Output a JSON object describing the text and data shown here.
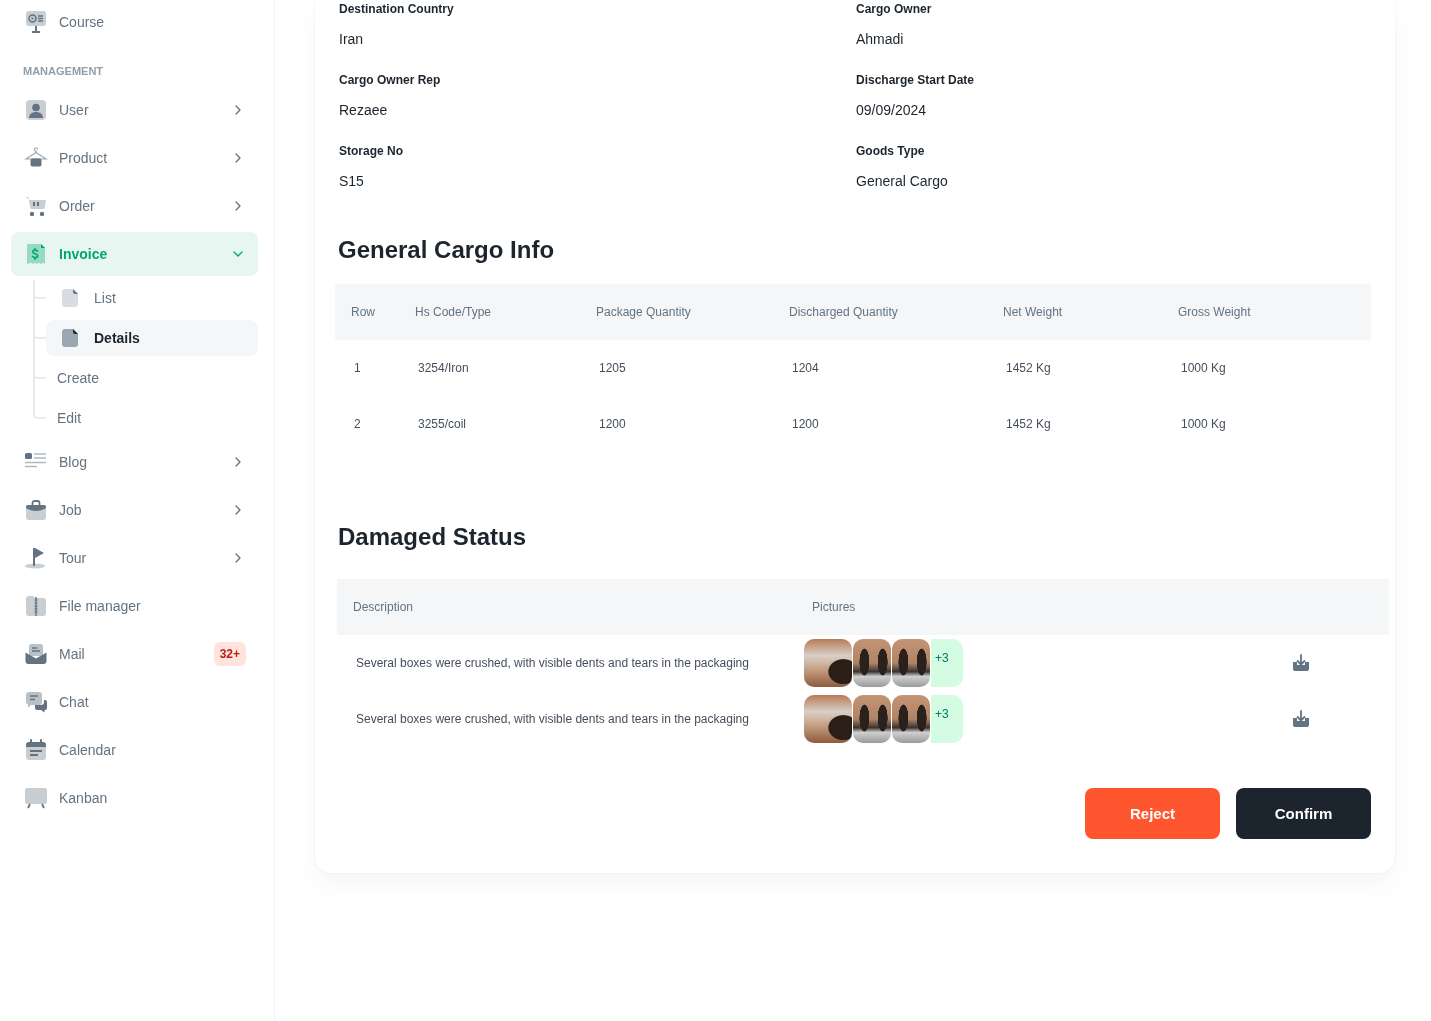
{
  "sidebar": {
    "sections": [
      {
        "items": [
          {
            "label": "Course",
            "kind": "link",
            "selected": false,
            "expanded": false
          }
        ]
      },
      {
        "title": "MANAGEMENT",
        "items": [
          {
            "label": "User",
            "kind": "group",
            "selected": false,
            "expanded": false
          },
          {
            "label": "Product",
            "kind": "group",
            "selected": false,
            "expanded": false
          },
          {
            "label": "Order",
            "kind": "group",
            "selected": false,
            "expanded": false
          },
          {
            "label": "Invoice",
            "kind": "group",
            "selected": true,
            "expanded": true,
            "children": [
              {
                "label": "List",
                "kind": "file",
                "selected": false
              },
              {
                "label": "Details",
                "kind": "file",
                "selected": true
              },
              {
                "label": "Create",
                "kind": "plain",
                "selected": false
              },
              {
                "label": "Edit",
                "kind": "plain",
                "selected": false
              }
            ]
          },
          {
            "label": "Blog",
            "kind": "group",
            "selected": false,
            "expanded": false
          },
          {
            "label": "Job",
            "kind": "group",
            "selected": false,
            "expanded": false
          },
          {
            "label": "Tour",
            "kind": "group",
            "selected": false,
            "expanded": false
          },
          {
            "label": "File manager",
            "kind": "link",
            "selected": false,
            "expanded": false
          },
          {
            "label": "Mail",
            "kind": "link",
            "selected": false,
            "expanded": false,
            "badge": "32+"
          },
          {
            "label": "Chat",
            "kind": "link",
            "selected": false,
            "expanded": false
          },
          {
            "label": "Calendar",
            "kind": "link",
            "selected": false,
            "expanded": false
          },
          {
            "label": "Kanban",
            "kind": "link",
            "selected": false,
            "expanded": false
          }
        ]
      }
    ]
  },
  "details": {
    "fields": [
      {
        "label": "Destination Country",
        "value": "Iran"
      },
      {
        "label": "Cargo Owner",
        "value": "Ahmadi"
      },
      {
        "label": "Cargo Owner Rep",
        "value": "Rezaee"
      },
      {
        "label": "Discharge Start Date",
        "value": "09/09/2024"
      },
      {
        "label": "Storage No",
        "value": "S15"
      },
      {
        "label": "Goods Type",
        "value": "General Cargo"
      }
    ]
  },
  "cargo_info": {
    "title": "General Cargo Info",
    "columns": [
      "Row",
      "Hs Code/Type",
      "Package Quantity",
      "Discharged Quantity",
      "Net Weight",
      "Gross Weight"
    ],
    "rows": [
      [
        "1",
        "3254/Iron",
        "1205",
        "1204",
        "1452 Kg",
        "1000 Kg"
      ],
      [
        "2",
        "3255/coil",
        "1200",
        "1200",
        "1452 Kg",
        "1000 Kg"
      ]
    ]
  },
  "damaged_status": {
    "title": "Damaged Status",
    "columns": [
      "Description",
      "Pictures"
    ],
    "rows": [
      {
        "description": "Several boxes were crushed, with visible dents and tears in the packaging",
        "photos": [
          {
            "kind": "pipe"
          },
          {
            "kind": "gear"
          },
          {
            "kind": "gear"
          }
        ],
        "more": "+3"
      },
      {
        "description": "Several boxes were crushed, with visible dents and tears in the packaging",
        "photos": [
          {
            "kind": "pipe"
          },
          {
            "kind": "gear"
          },
          {
            "kind": "gear"
          }
        ],
        "more": "+3"
      }
    ]
  },
  "actions": [
    {
      "label": "Reject",
      "kind": "danger"
    },
    {
      "label": "Confirm",
      "kind": "primary"
    }
  ]
}
